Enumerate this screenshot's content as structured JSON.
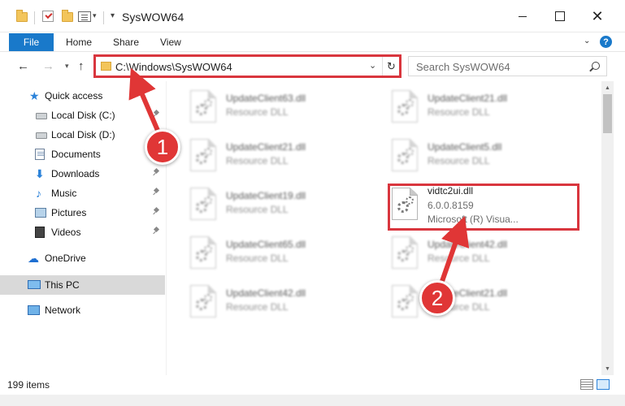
{
  "window": {
    "title": "SysWOW64"
  },
  "ribbon": {
    "file_tab": "File",
    "tabs": [
      "Home",
      "Share",
      "View"
    ],
    "help_label": "?"
  },
  "navigation": {
    "back_icon": "back-arrow-icon",
    "forward_icon": "forward-arrow-icon",
    "recent_icon": "chevron-down-icon",
    "up_icon": "up-arrow-icon"
  },
  "address_bar": {
    "path": "C:\\Windows\\SysWOW64"
  },
  "search": {
    "placeholder": "Search SysWOW64"
  },
  "sidebar": {
    "items": [
      {
        "label": "Quick access",
        "icon": "star-icon"
      },
      {
        "label": "Local Disk (C:)",
        "icon": "drive-icon",
        "pinned": true
      },
      {
        "label": "Local Disk (D:)",
        "icon": "drive-icon"
      },
      {
        "label": "Documents",
        "icon": "documents-icon",
        "pinned": true
      },
      {
        "label": "Downloads",
        "icon": "download-icon",
        "pinned": true
      },
      {
        "label": "Music",
        "icon": "music-icon",
        "pinned": true
      },
      {
        "label": "Pictures",
        "icon": "pictures-icon",
        "pinned": true
      },
      {
        "label": "Videos",
        "icon": "videos-icon",
        "pinned": true
      },
      {
        "label": "OneDrive",
        "icon": "cloud-icon"
      },
      {
        "label": "This PC",
        "icon": "computer-icon",
        "selected": true
      },
      {
        "label": "Network",
        "icon": "network-icon"
      }
    ]
  },
  "files": [
    {
      "name": "UpdateClient63.dll",
      "type": "Resource DLL"
    },
    {
      "name": "UpdateClient21.dll",
      "type": "Resource DLL"
    },
    {
      "name": "UpdateClient21.dll",
      "type": "Resource DLL"
    },
    {
      "name": "UpdateClient5.dll",
      "type": "Resource DLL"
    },
    {
      "name": "UpdateClient19.dll",
      "type": "Resource DLL"
    },
    {
      "name": "vidtc2ui.dll",
      "version": "6.0.0.8159",
      "company": "Microsoft (R) Visua..."
    },
    {
      "name": "UpdateClient65.dll",
      "type": "Resource DLL"
    },
    {
      "name": "UpdateClient42.dll",
      "type": "Resource DLL"
    },
    {
      "name": "UpdateClient42.dll",
      "type": "Resource DLL"
    },
    {
      "name": "UpdateClient21.dll",
      "type": "Resource DLL"
    }
  ],
  "status": {
    "item_count": "199 items"
  },
  "annotations": {
    "step1": "1",
    "step2": "2",
    "color": "#d9363e"
  }
}
